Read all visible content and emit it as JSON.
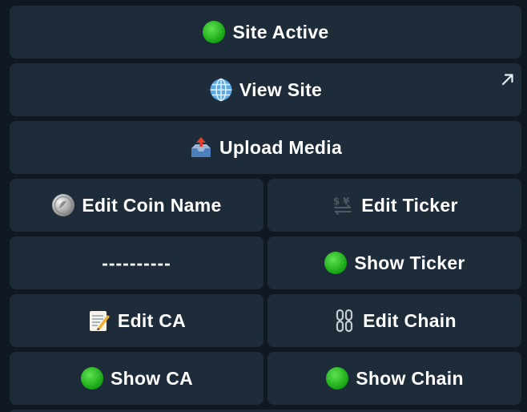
{
  "colors": {
    "background": "#101921",
    "button": "#1e2c3a",
    "text": "#ffffff",
    "green_status": "#1fbf1a"
  },
  "buttons": {
    "site_active": {
      "icon": "green-circle-icon",
      "label": "Site Active"
    },
    "view_site": {
      "icon": "globe-icon",
      "label": "View Site",
      "corner_icon": "external-link-arrow-icon"
    },
    "upload_media": {
      "icon": "outbox-tray-icon",
      "label": "Upload Media"
    },
    "edit_coin_name": {
      "icon": "coin-icon",
      "label": "Edit Coin Name"
    },
    "edit_ticker": {
      "icon": "currency-exchange-icon",
      "label": "Edit Ticker"
    },
    "separator": {
      "label": "----------"
    },
    "show_ticker": {
      "icon": "green-circle-icon",
      "label": "Show Ticker"
    },
    "edit_ca": {
      "icon": "memo-icon",
      "label": "Edit CA"
    },
    "edit_chain": {
      "icon": "chains-icon",
      "label": "Edit Chain"
    },
    "show_ca": {
      "icon": "green-circle-icon",
      "label": "Show CA"
    },
    "show_chain": {
      "icon": "green-circle-icon",
      "label": "Show Chain"
    }
  }
}
